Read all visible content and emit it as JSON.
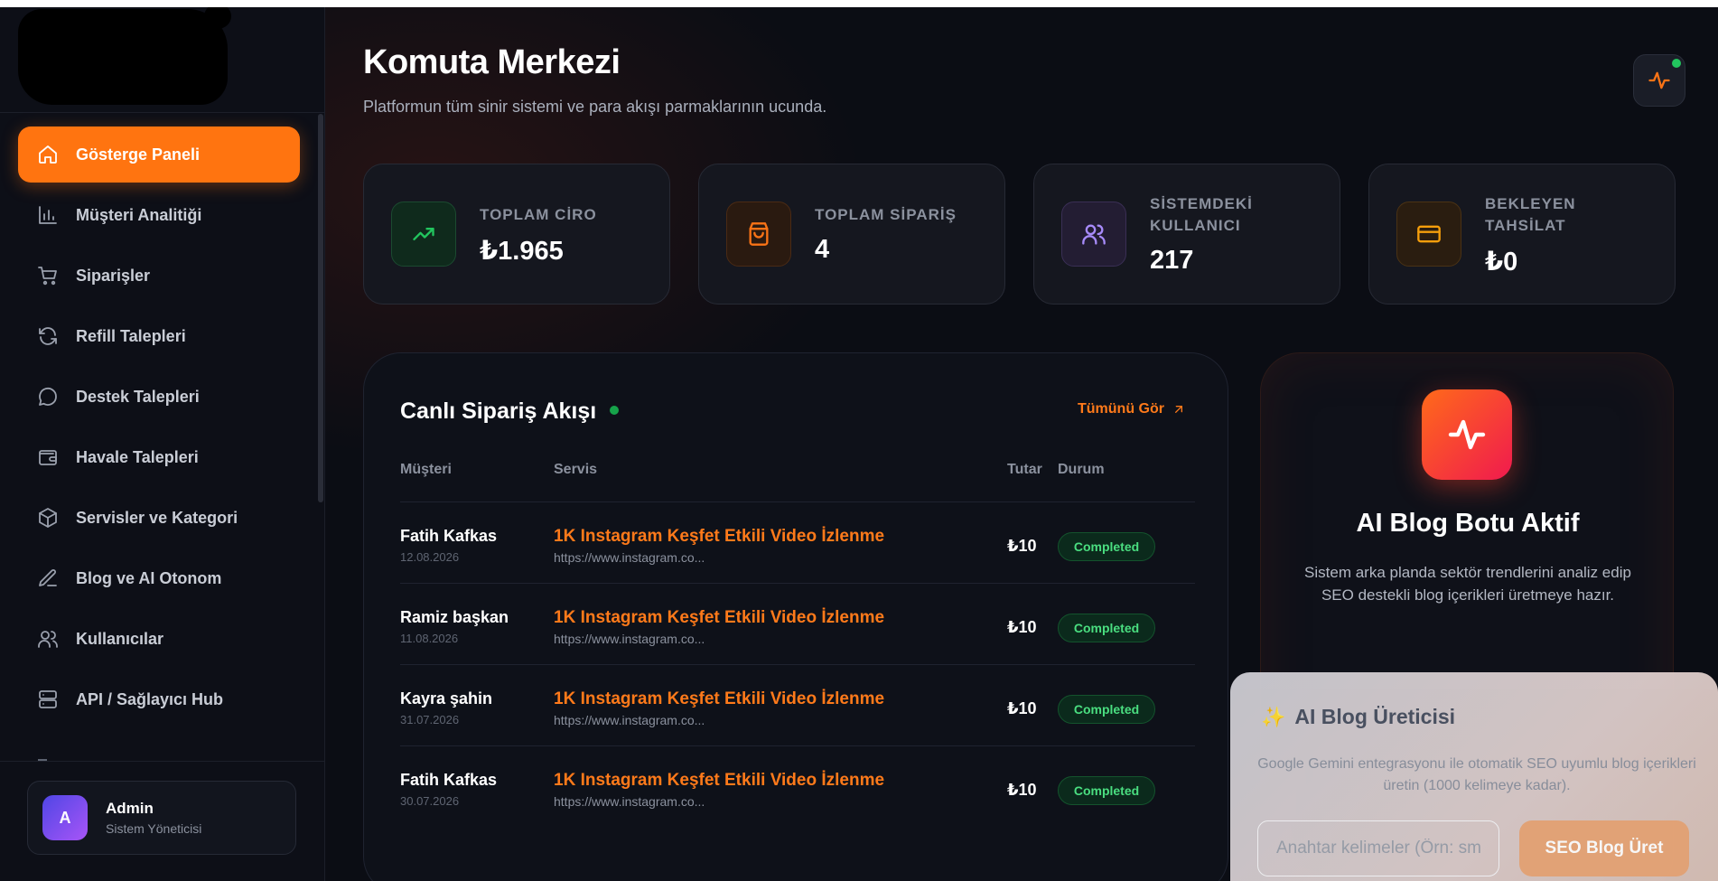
{
  "sidebar": {
    "items": [
      {
        "label": "Gösterge Paneli",
        "icon": "home-icon",
        "active": true
      },
      {
        "label": "Müşteri Analitiği",
        "icon": "bar-chart-icon"
      },
      {
        "label": "Siparişler",
        "icon": "cart-icon"
      },
      {
        "label": "Refill Talepleri",
        "icon": "refresh-icon"
      },
      {
        "label": "Destek Talepleri",
        "icon": "chat-bubble-icon"
      },
      {
        "label": "Havale Talepleri",
        "icon": "wallet-icon"
      },
      {
        "label": "Servisler ve Kategori",
        "icon": "box-icon"
      },
      {
        "label": "Blog ve AI Otonom",
        "icon": "pen-icon"
      },
      {
        "label": "Kullanıcılar",
        "icon": "users-icon"
      },
      {
        "label": "API / Sağlayıcı Hub",
        "icon": "server-icon"
      }
    ],
    "admin": {
      "initial": "A",
      "name": "Admin",
      "role": "Sistem Yöneticisi"
    }
  },
  "header": {
    "title": "Komuta Merkezi",
    "subtitle": "Platformun tüm sinir sistemi ve para akışı parmaklarının ucunda."
  },
  "stats": [
    {
      "label": "TOPLAM CİRO",
      "value": "₺1.965",
      "icon": "trending-up-icon",
      "color": "#22c55e"
    },
    {
      "label": "TOPLAM SİPARİŞ",
      "value": "4",
      "icon": "shopping-bag-icon",
      "color": "#f97316"
    },
    {
      "label": "SİSTEMDEKİ KULLANICI",
      "value": "217",
      "icon": "users-icon",
      "color": "#a78bfa"
    },
    {
      "label": "BEKLEYEN TAHSİLAT",
      "value": "₺0",
      "icon": "credit-card-icon",
      "color": "#f59e0b"
    }
  ],
  "orders": {
    "title": "Canlı Sipariş Akışı",
    "see_all": "Tümünü Gör",
    "columns": {
      "customer": "Müşteri",
      "service": "Servis",
      "amount": "Tutar",
      "status": "Durum"
    },
    "rows": [
      {
        "customer": "Fatih Kafkas",
        "date": "12.08.2026",
        "service": "1K Instagram Keşfet Etkili Video İzlenme",
        "url": "https://www.instagram.co...",
        "amount": "₺10",
        "status": "Completed"
      },
      {
        "customer": "Ramiz başkan",
        "date": "11.08.2026",
        "service": "1K Instagram Keşfet Etkili Video İzlenme",
        "url": "https://www.instagram.co...",
        "amount": "₺10",
        "status": "Completed"
      },
      {
        "customer": "Kayra şahin",
        "date": "31.07.2026",
        "service": "1K Instagram Keşfet Etkili Video İzlenme",
        "url": "https://www.instagram.co...",
        "amount": "₺10",
        "status": "Completed"
      },
      {
        "customer": "Fatih Kafkas",
        "date": "30.07.2026",
        "service": "1K Instagram Keşfet Etkili Video İzlenme",
        "url": "https://www.instagram.co...",
        "amount": "₺10",
        "status": "Completed"
      }
    ]
  },
  "ai_card": {
    "title": "AI Blog Botu Aktif",
    "description": "Sistem arka planda sektör trendlerini analiz edip SEO destekli blog içerikleri üretmeye hazır."
  },
  "generator": {
    "title": "AI Blog Üreticisi",
    "description": "Google Gemini entegrasyonu ile otomatik SEO uyumlu blog içerikleri üretin (1000 kelimeye kadar).",
    "input_placeholder": "Anahtar kelimeler (Örn: sm",
    "button_label": "SEO Blog Üret"
  },
  "colors": {
    "accent": "#ff7410",
    "success": "#4ade80",
    "background": "#0b0d14"
  }
}
